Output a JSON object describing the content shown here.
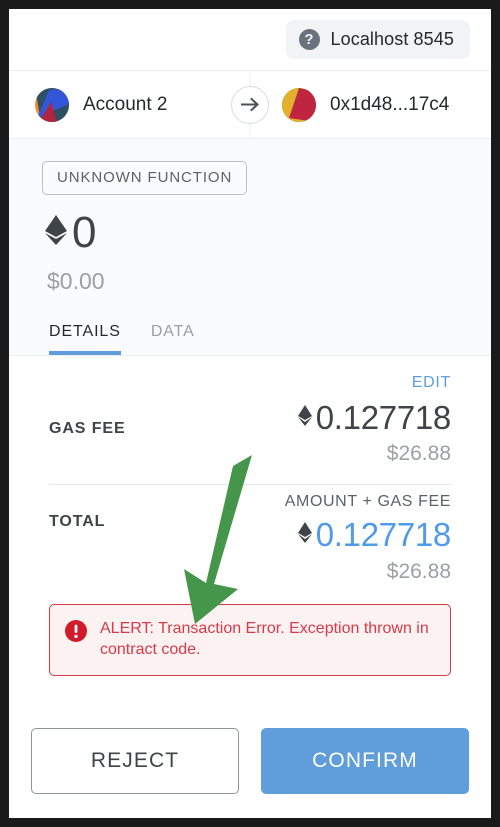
{
  "network": {
    "icon": "question-circle-icon",
    "label": "Localhost 8545"
  },
  "accounts": {
    "from": {
      "name": "Account 2",
      "avatar": "jazzicon-blue"
    },
    "to": {
      "name": "0x1d48...17c4",
      "avatar": "jazzicon-red"
    },
    "direction_icon": "arrow-right-icon"
  },
  "summary": {
    "function_label": "UNKNOWN FUNCTION",
    "currency_symbol": "ETH",
    "amount": "0",
    "fiat_amount": "$0.00"
  },
  "tabs": [
    {
      "label": "DETAILS",
      "active": true
    },
    {
      "label": "DATA",
      "active": false
    }
  ],
  "details": {
    "edit_label": "EDIT",
    "gas_fee": {
      "label": "GAS FEE",
      "eth": "0.127718",
      "fiat": "$26.88"
    },
    "total": {
      "label": "TOTAL",
      "sublabel": "AMOUNT + GAS FEE",
      "eth": "0.127718",
      "fiat": "$26.88"
    }
  },
  "alert": {
    "icon": "error-circle-icon",
    "message": "ALERT: Transaction Error. Exception thrown in contract code."
  },
  "footer": {
    "reject_label": "REJECT",
    "confirm_label": "CONFIRM"
  },
  "annotation": {
    "type": "arrow",
    "color": "#45964a",
    "points_to": "alert"
  },
  "colors": {
    "accent_blue": "#5f9ddb",
    "total_blue": "#4f9aea",
    "error_red": "#d73a49",
    "alert_bg": "#fdf2f2",
    "annotation_green": "#45964a",
    "text_dark": "#24292e",
    "text_muted": "#9aa0a6"
  }
}
